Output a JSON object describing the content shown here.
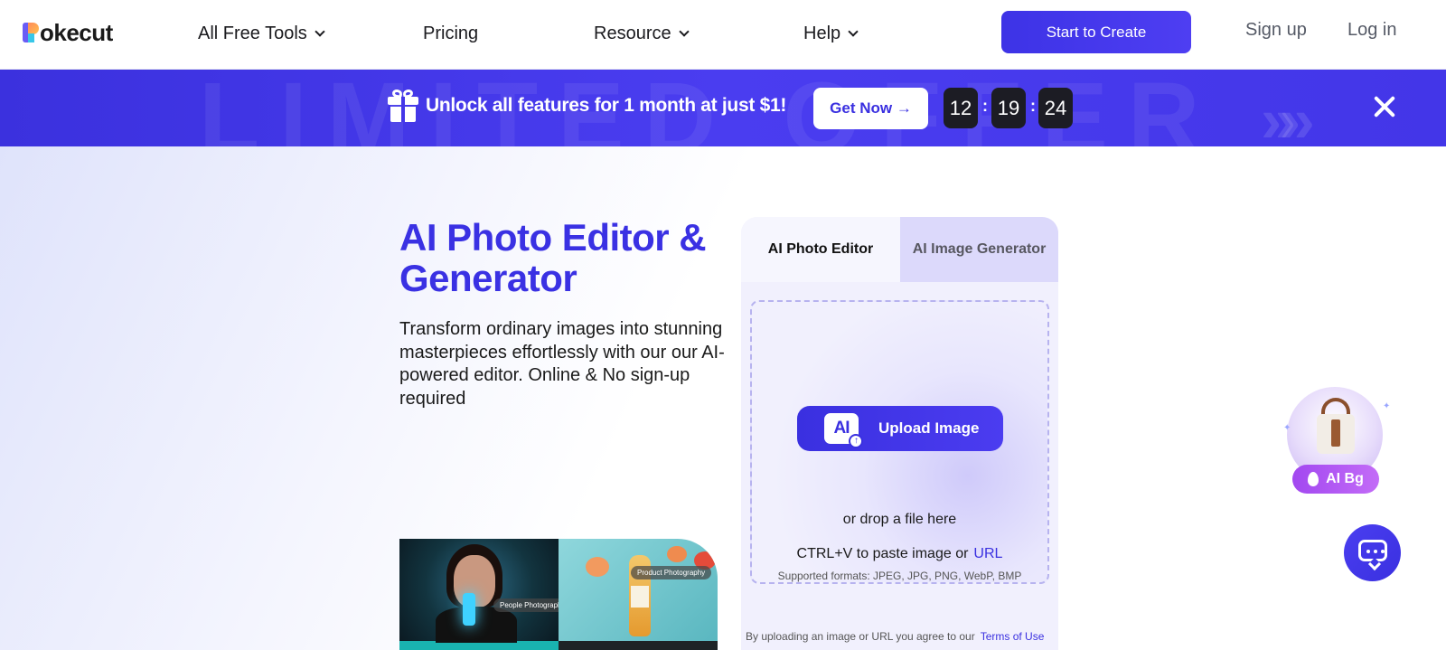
{
  "nav": {
    "logo_text": "okecut",
    "items": [
      {
        "label": "All Free Tools"
      },
      {
        "label": "Pricing"
      },
      {
        "label": "Resource"
      },
      {
        "label": "Help"
      }
    ],
    "cta_label": "Start to Create",
    "signup_label": "Sign up",
    "login_label": "Log in"
  },
  "banner": {
    "bg_text": "LIMITED OFFER",
    "text": "Unlock all features for 1 month at just $1!",
    "button_label": "Get Now →",
    "timer": {
      "hours": "12",
      "minutes": "19",
      "seconds": "24",
      "sep": ":"
    }
  },
  "hero": {
    "title": "AI Photo Editor & Generator",
    "description": "Transform ordinary images into stunning masterpieces effortlessly with our our AI-powered editor. Online & No sign-up required",
    "gallery_tags": [
      "People Photography",
      "Product Photography"
    ]
  },
  "panel": {
    "tabs": [
      {
        "label": "AI Photo Editor",
        "active": true
      },
      {
        "label": "AI Image Generator",
        "active": false
      }
    ],
    "upload_icon_text": "AI",
    "upload_label": "Upload Image",
    "drop_text": "or drop a file here",
    "paste_text": "CTRL+V to paste image or",
    "url_label": "URL",
    "formats_text": "Supported formats: JPEG, JPG, PNG, WebP, BMP",
    "terms_text": "By uploading an image or URL you agree to our",
    "terms_link": "Terms of Use"
  },
  "floating": {
    "aibg_label": "AI Bg"
  },
  "colors": {
    "brand": "#3a30e0",
    "banner_bg": "#4336e8",
    "dark_timer": "#1c1c24",
    "ai_bg_pill": "#b05af3"
  }
}
